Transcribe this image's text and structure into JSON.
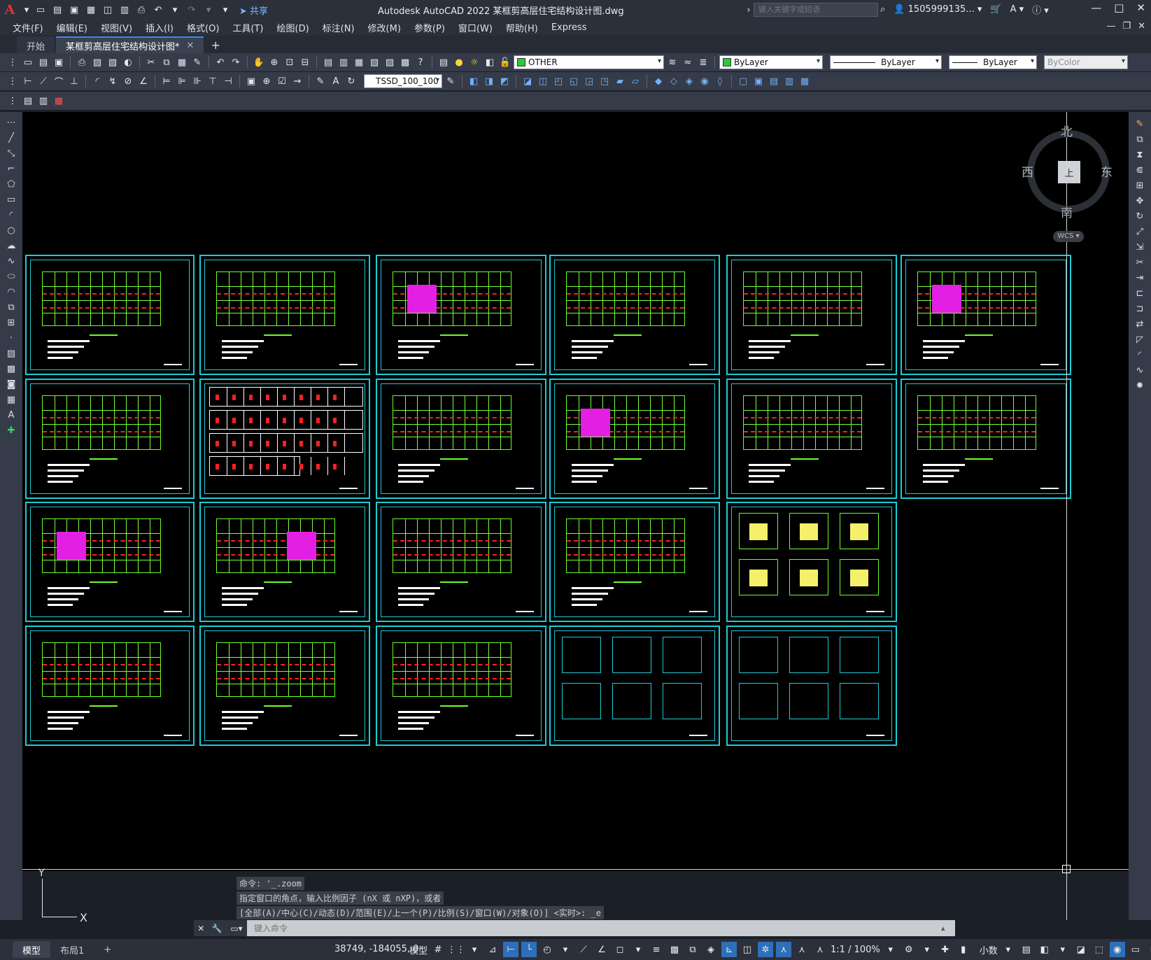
{
  "app": {
    "logo": "A",
    "title": "Autodesk AutoCAD 2022    某框剪高层住宅结构设计图.dwg",
    "share_label": "共享",
    "search_placeholder": "键入关键字或短语",
    "user": "1505999135...",
    "help": "?"
  },
  "menu": [
    "文件(F)",
    "编辑(E)",
    "视图(V)",
    "插入(I)",
    "格式(O)",
    "工具(T)",
    "绘图(D)",
    "标注(N)",
    "修改(M)",
    "参数(P)",
    "窗口(W)",
    "帮助(H)",
    "Express"
  ],
  "tabs": [
    {
      "label": "开始",
      "active": false
    },
    {
      "label": "某框剪高层住宅结构设计图*",
      "active": true
    }
  ],
  "toolbar": {
    "layer_name": "OTHER",
    "color": "ByLayer",
    "linetype": "ByLayer",
    "lineweight": "ByLayer",
    "plotstyle": "ByColor",
    "dimstyle": "TSSD_100_100"
  },
  "viewcube": {
    "north": "北",
    "south": "南",
    "east": "东",
    "west": "西",
    "face": "上",
    "wcs": "WCS"
  },
  "ucs": {
    "x": "X",
    "y": "Y"
  },
  "command": {
    "history": [
      "命令: '_.zoom",
      "指定窗口的角点，输入比例因子 (nX 或 nXP)，或者",
      "[全部(A)/中心(C)/动态(D)/范围(E)/上一个(P)/比例(S)/窗口(W)/对象(O)] <实时>: _e"
    ],
    "placeholder": "键入命令"
  },
  "status": {
    "model_tab": "模型",
    "layout_tab": "布局1",
    "coords": "38749, -184055, 0",
    "mode": "模型",
    "scale": "1:1 / 100%",
    "units": "小数"
  },
  "colors": {
    "sheet_border": "#1ecbd6",
    "plan_lines": "#6bff2a",
    "axis_lines": "#ff2020",
    "hatch": "#e21fe2",
    "accent": "#3c8ae6"
  }
}
